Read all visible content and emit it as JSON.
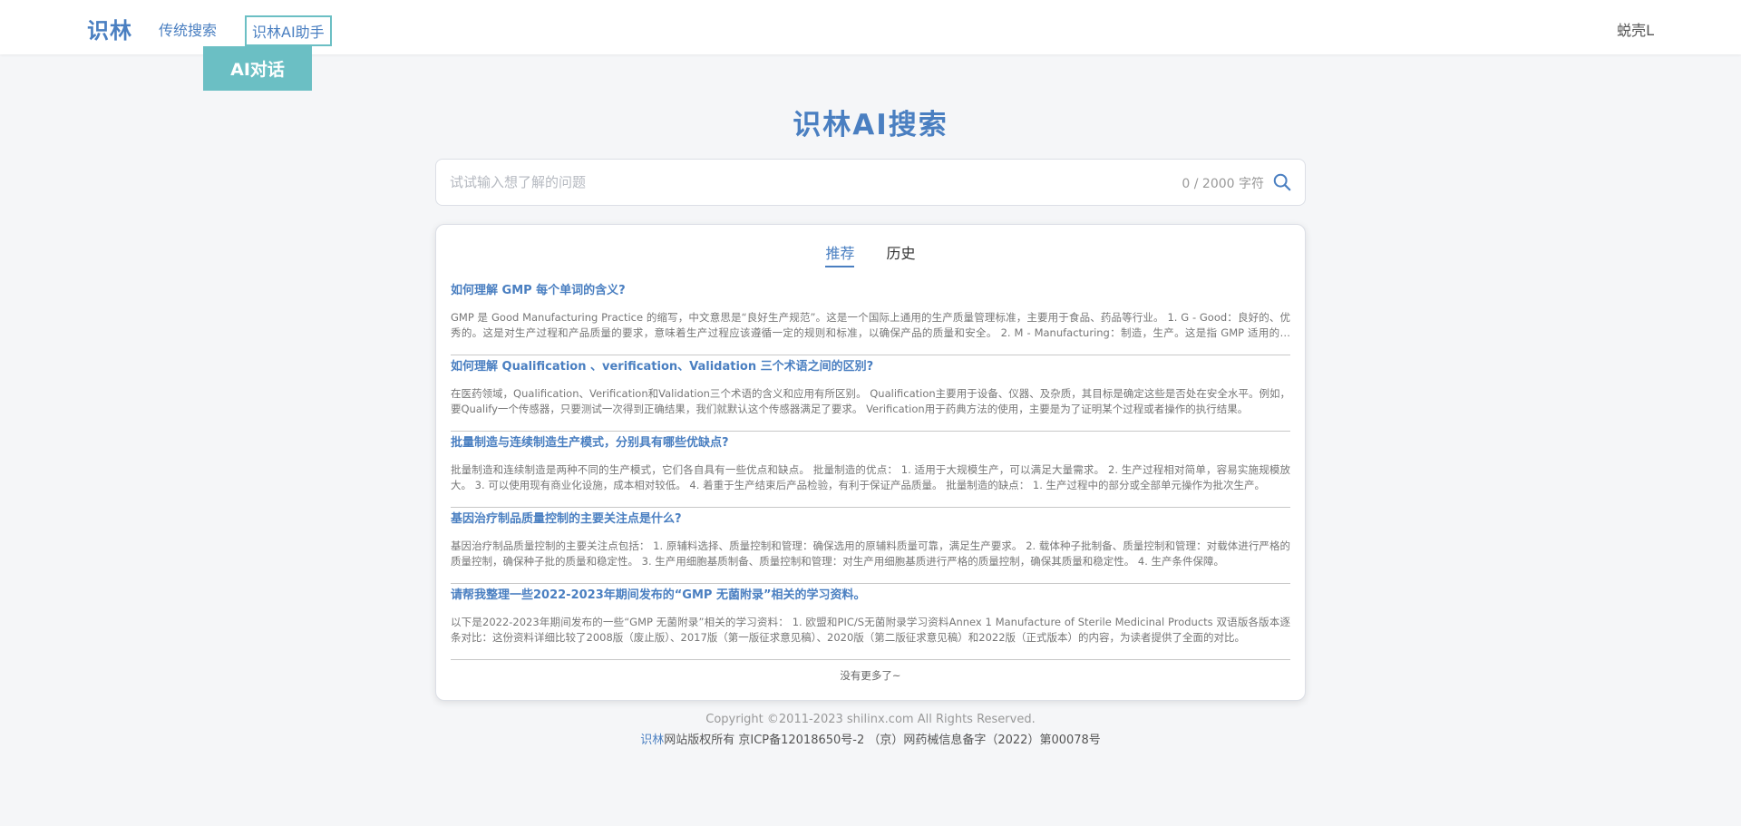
{
  "header": {
    "logo": "识林",
    "nav": {
      "traditional_search": "传统搜索",
      "ai_assistant": "识林AI助手"
    },
    "user": "蜕壳L",
    "ai_chat_button": "AI对话"
  },
  "main": {
    "title": "识林AI搜索",
    "search": {
      "placeholder": "试试输入想了解的问题",
      "char_count": "0 / 2000 字符"
    },
    "tabs": [
      {
        "label": "推荐",
        "active": true
      },
      {
        "label": "历史",
        "active": false
      }
    ],
    "items": [
      {
        "question": "如何理解 GMP 每个单词的含义?",
        "answer": "GMP 是 Good Manufacturing Practice 的缩写，中文意思是“良好生产规范”。这是一个国际上通用的生产质量管理标准，主要用于食品、药品等行业。 1. G - Good：良好的、优秀的。这是对生产过程和产品质量的要求，意味着生产过程应该遵循一定的规则和标准，以确保产品的质量和安全。 2. M - Manufacturing：制造，生产。这是指 GMP 适用的范围，即生产制造过程。"
      },
      {
        "question": "如何理解 Qualification 、verification、Validation 三个术语之间的区别?",
        "answer": "在医药领域，Qualification、Verification和Validation三个术语的含义和应用有所区别。 Qualification主要用于设备、仪器、及杂质，其目标是确定这些是否处在安全水平。例如，要Qualify一个传感器，只要测试一次得到正确结果，我们就默认这个传感器满足了要求。 Verification用于药典方法的使用，主要是为了证明某个过程或者操作的执行结果。"
      },
      {
        "question": "批量制造与连续制造生产模式，分别具有哪些优缺点?",
        "answer": "批量制造和连续制造是两种不同的生产模式，它们各自具有一些优点和缺点。 批量制造的优点： 1. 适用于大规模生产，可以满足大量需求。 2. 生产过程相对简单，容易实施规模放大。 3. 可以使用现有商业化设施，成本相对较低。 4. 着重于生产结束后产品检验，有利于保证产品质量。 批量制造的缺点： 1. 生产过程中的部分或全部单元操作为批次生产。"
      },
      {
        "question": "基因治疗制品质量控制的主要关注点是什么?",
        "answer": "基因治疗制品质量控制的主要关注点包括： 1. 原辅料选择、质量控制和管理：确保选用的原辅料质量可靠，满足生产要求。 2. 载体种子批制备、质量控制和管理：对载体进行严格的质量控制，确保种子批的质量和稳定性。 3. 生产用细胞基质制备、质量控制和管理：对生产用细胞基质进行严格的质量控制，确保其质量和稳定性。 4. 生产条件保障。"
      },
      {
        "question": "请帮我整理一些2022-2023年期间发布的“GMP 无菌附录”相关的学习资料。",
        "answer": "以下是2022-2023年期间发布的一些“GMP 无菌附录”相关的学习资料： 1. 欧盟和PIC/S无菌附录学习资料Annex 1 Manufacture of Sterile Medicinal Products 双语版各版本逐条对比：这份资料详细比较了2008版（废止版）、2017版（第一版征求意见稿）、2020版（第二版征求意见稿）和2022版（正式版本）的内容，为读者提供了全面的对比。"
      }
    ],
    "no_more": "没有更多了~"
  },
  "footer": {
    "copyright": "Copyright ©2011-2023 shilinx.com All Rights Reserved.",
    "brand": "识林",
    "rights": "网站版权所有",
    "icp": "京ICP备12018650号-2 （京）网药械信息备字（2022）第00078号"
  },
  "colors": {
    "brand_blue": "#4a7fc1",
    "accent_teal": "#6bbfc4"
  }
}
